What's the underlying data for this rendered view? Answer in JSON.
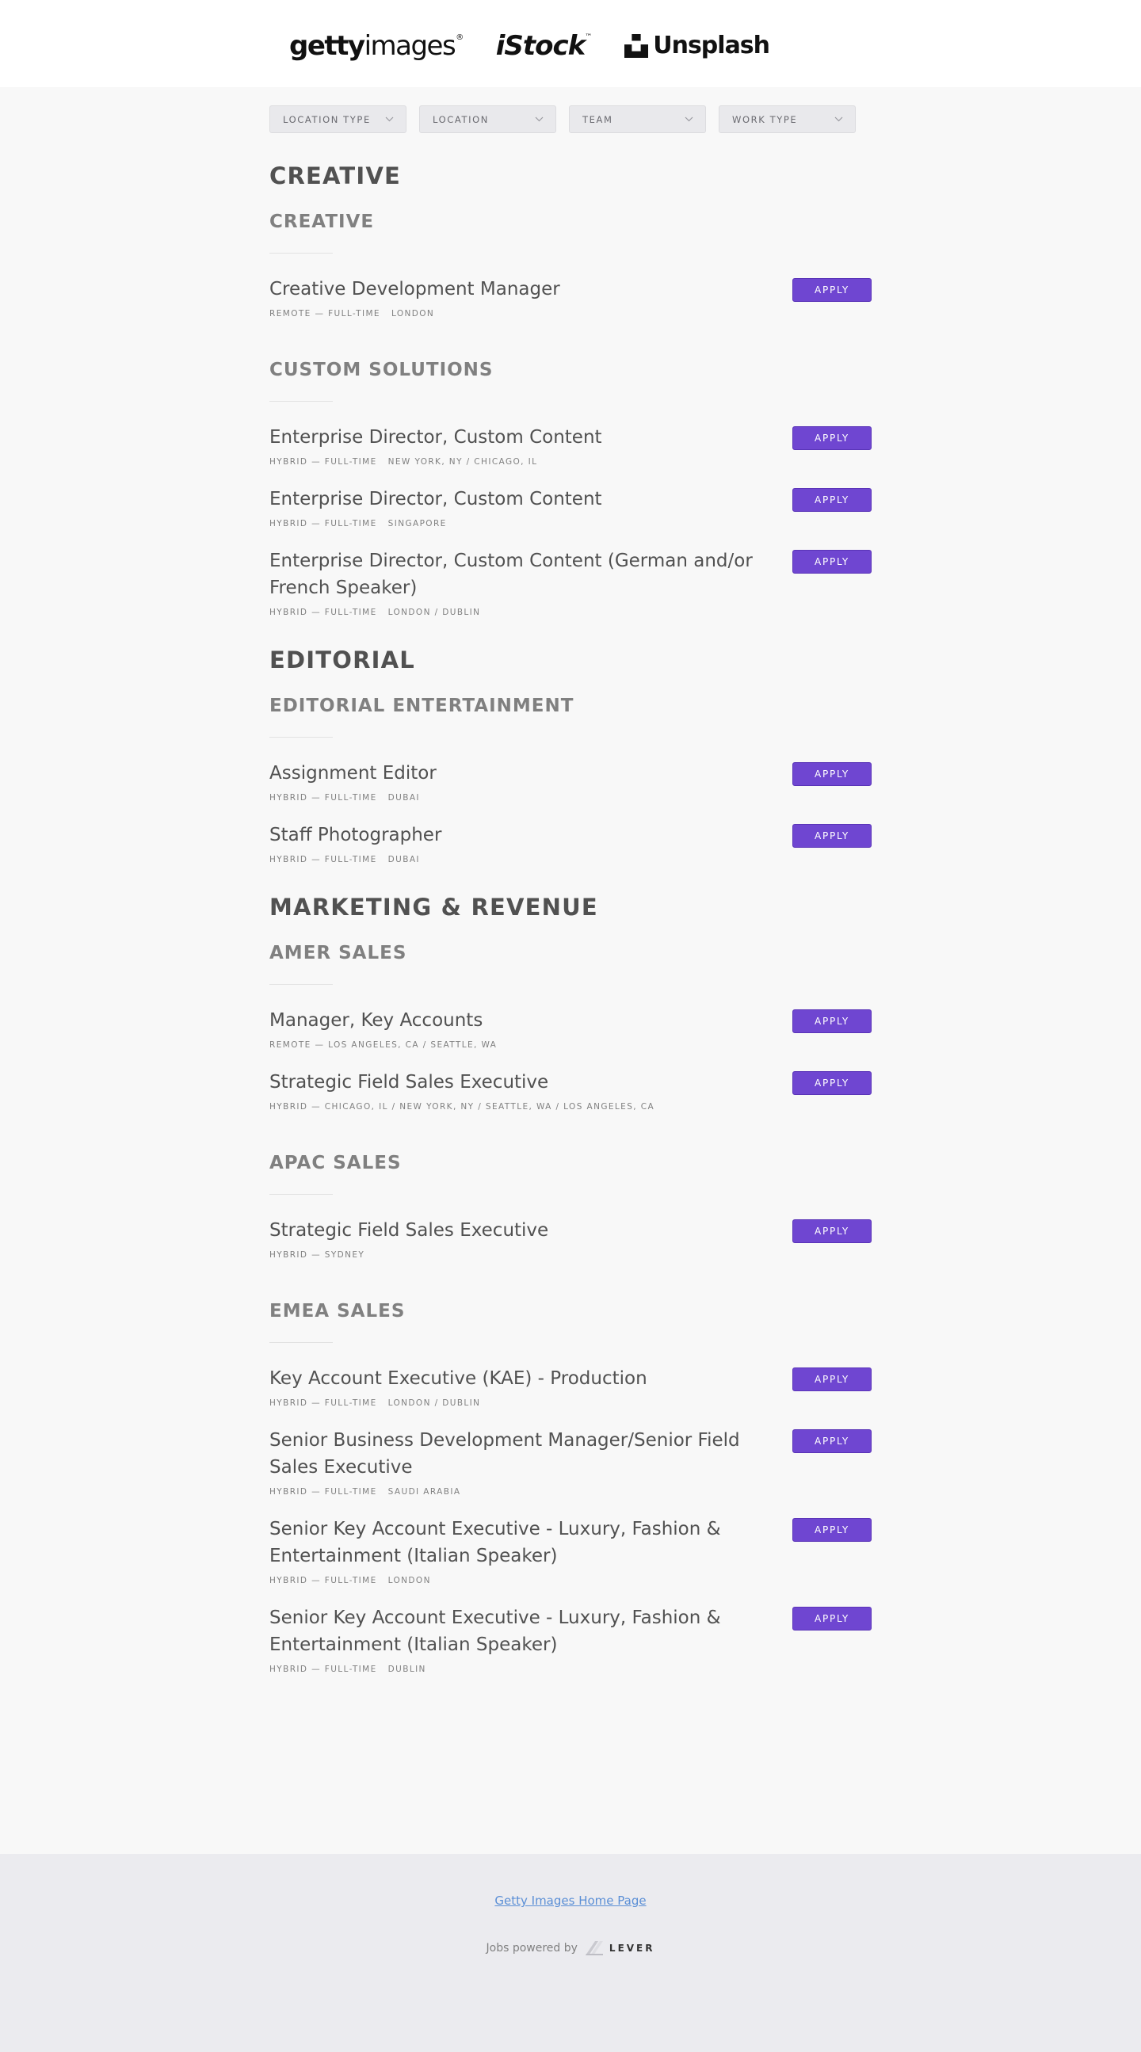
{
  "header": {
    "logos": {
      "getty_bold": "getty",
      "getty_light": "images",
      "getty_mark": "®",
      "istock": "iStock",
      "istock_mark": "™",
      "unsplash": "Unsplash"
    }
  },
  "filters": [
    {
      "label": "Location type"
    },
    {
      "label": "Location"
    },
    {
      "label": "Team"
    },
    {
      "label": "Work type"
    }
  ],
  "departments": [
    {
      "title": "Creative",
      "teams": [
        {
          "title": "Creative",
          "postings": [
            {
              "title": "Creative Development Manager",
              "commitment": "Remote — Full-time",
              "location": "London"
            }
          ]
        },
        {
          "title": "Custom Solutions",
          "postings": [
            {
              "title": "Enterprise Director, Custom Content",
              "commitment": "Hybrid — Full-time",
              "location": "New York, NY / Chicago, IL"
            },
            {
              "title": "Enterprise Director, Custom Content",
              "commitment": "Hybrid — Full-time",
              "location": "Singapore"
            },
            {
              "title": "Enterprise Director, Custom Content (German and/or French Speaker)",
              "commitment": "Hybrid — Full-time",
              "location": "London / Dublin"
            }
          ]
        }
      ]
    },
    {
      "title": "Editorial",
      "teams": [
        {
          "title": "Editorial Entertainment",
          "postings": [
            {
              "title": "Assignment Editor",
              "commitment": "Hybrid — Full-time",
              "location": "Dubai"
            },
            {
              "title": "Staff Photographer",
              "commitment": "Hybrid — Full-time",
              "location": "Dubai"
            }
          ]
        }
      ]
    },
    {
      "title": "Marketing & Revenue",
      "teams": [
        {
          "title": "AMER Sales",
          "postings": [
            {
              "title": "Manager, Key Accounts",
              "commitment": "Remote — Los Angeles, CA / Seattle, WA",
              "location": ""
            },
            {
              "title": "Strategic Field Sales Executive",
              "commitment": "Hybrid — Chicago, IL / New York, NY / Seattle, WA / Los Angeles, CA",
              "location": ""
            }
          ]
        },
        {
          "title": "APAC Sales",
          "postings": [
            {
              "title": "Strategic Field Sales Executive",
              "commitment": "Hybrid — Sydney",
              "location": ""
            }
          ]
        },
        {
          "title": "EMEA Sales",
          "postings": [
            {
              "title": "Key Account Executive (KAE) - Production",
              "commitment": "Hybrid — Full-time",
              "location": "London / Dublin"
            },
            {
              "title": "Senior Business Development Manager/Senior Field Sales Executive",
              "commitment": "Hybrid — Full-time",
              "location": "Saudi Arabia"
            },
            {
              "title": "Senior Key Account Executive - Luxury, Fashion & Entertainment (Italian Speaker)",
              "commitment": "Hybrid — Full-time",
              "location": "London"
            },
            {
              "title": "Senior Key Account Executive - Luxury, Fashion & Entertainment (Italian Speaker)",
              "commitment": "Hybrid — Full-time",
              "location": "Dublin"
            }
          ]
        }
      ]
    }
  ],
  "apply_label": "Apply",
  "footer": {
    "home_link": "Getty Images Home Page",
    "powered_by": "Jobs powered by",
    "lever": "LEVER"
  },
  "colors": {
    "apply_bg": "#6f46d1",
    "link": "#5b8fd6",
    "page_bg": "#f8f8f8",
    "footer_bg": "#ebebef"
  }
}
